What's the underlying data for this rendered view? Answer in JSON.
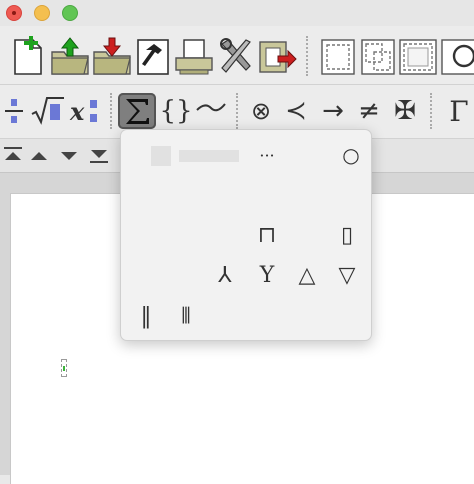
{
  "window": {
    "buttons": [
      "close",
      "minimize",
      "maximize"
    ]
  },
  "toolbar": {
    "main_icons": [
      "new-document-icon",
      "open-icon",
      "save-icon",
      "hammer-icon",
      "print-icon",
      "tools-icon",
      "export-icon",
      "page-view-icon",
      "page-view-2-icon",
      "page-view-3-icon",
      "zoom-icon"
    ]
  },
  "math_toolbar": {
    "items": [
      {
        "name": "fraction-icon",
        "label": "÷"
      },
      {
        "name": "root-icon",
        "label": "√"
      },
      {
        "name": "script-icon",
        "label": "x:"
      },
      {
        "name": "big-operator",
        "label": "∑"
      },
      {
        "name": "brackets",
        "label": "{}"
      },
      {
        "name": "wide-accent",
        "label": "⁀"
      },
      {
        "name": "circled-times",
        "label": "⊗"
      },
      {
        "name": "precedes",
        "label": "≺"
      },
      {
        "name": "right-arrow",
        "label": "→"
      },
      {
        "name": "not-equal",
        "label": "≠"
      },
      {
        "name": "maltese-cross",
        "label": "✠"
      },
      {
        "name": "gamma",
        "label": "Γ"
      }
    ]
  },
  "popup": {
    "symbols": [
      {
        "name": "ellipsis",
        "label": "···"
      },
      {
        "name": "circle",
        "label": "○"
      },
      {
        "name": "square-cap",
        "label": "⊓"
      },
      {
        "name": "square",
        "label": "▯"
      },
      {
        "name": "lambda-like",
        "label": "⅄"
      },
      {
        "name": "curly-wedge",
        "label": "Y"
      },
      {
        "name": "triangle-up",
        "label": "△"
      },
      {
        "name": "triangle-down",
        "label": "▽"
      },
      {
        "name": "double-bar",
        "label": "‖"
      },
      {
        "name": "triple-bar",
        "label": "⦀"
      }
    ]
  },
  "colors": {
    "accent_green": "#1ea21e",
    "accent_red": "#cc1f1f",
    "active_bg": "#7f7f7f"
  }
}
